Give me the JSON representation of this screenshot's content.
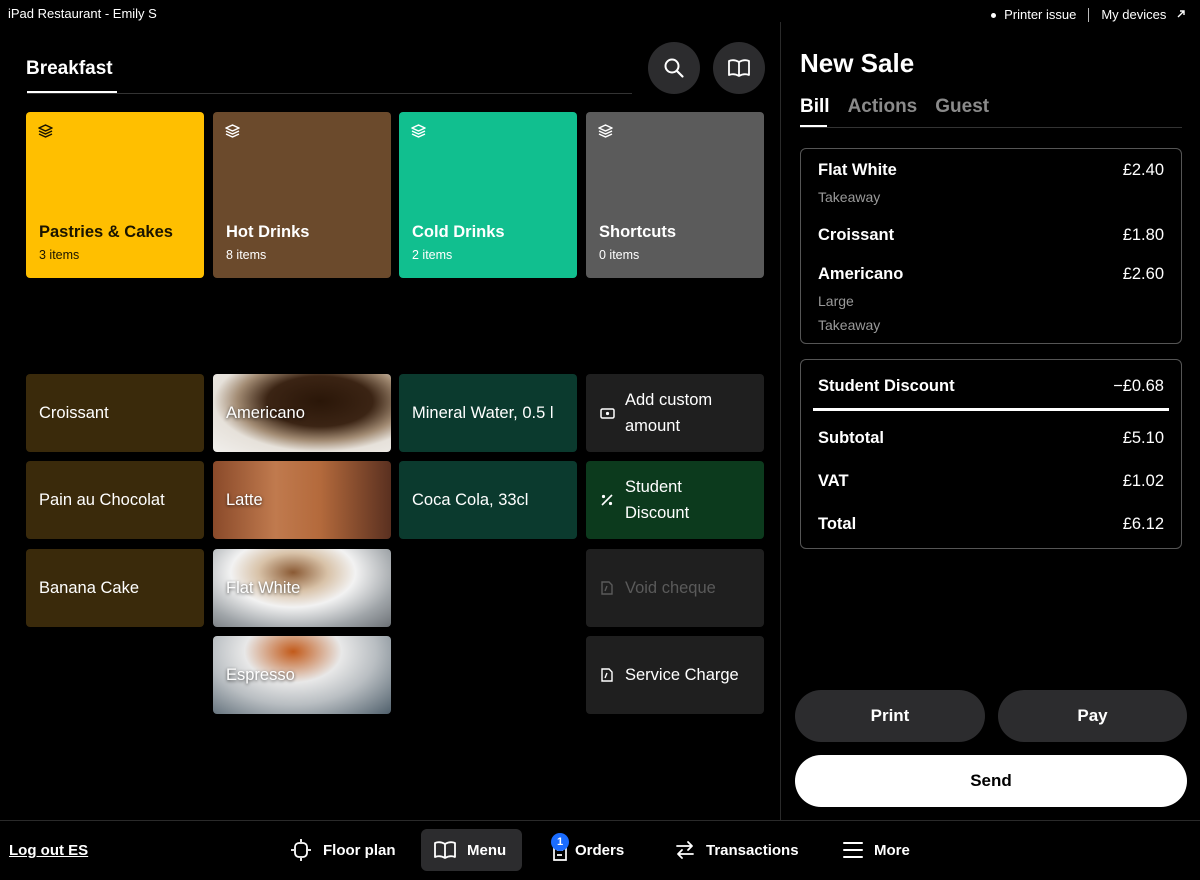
{
  "status_bar": {
    "left": "iPad Restaurant - Emily S",
    "printer_issue": "Printer issue",
    "my_devices": "My devices"
  },
  "menu": {
    "section_title": "Breakfast",
    "categories": [
      {
        "name": "Pastries & Cakes",
        "count": "3 items",
        "color": "#ffbf00",
        "text_color": "#1a1400"
      },
      {
        "name": "Hot Drinks",
        "count": "8 items",
        "color": "#6b4a2c",
        "text_color": "#ffffff"
      },
      {
        "name": "Cold Drinks",
        "count": "2 items",
        "color": "#11bf8f",
        "text_color": "#ffffff"
      },
      {
        "name": "Shortcuts",
        "count": "0 items",
        "color": "#5b5b5b",
        "text_color": "#ffffff"
      }
    ],
    "food_items": [
      "Croissant",
      "Pain au Chocolat",
      "Banana Cake"
    ],
    "photo_items": [
      "Americano",
      "Latte",
      "Flat White",
      "Espresso"
    ],
    "drink_items": [
      "Mineral Water, 0.5 l",
      "Coca Cola, 33cl"
    ],
    "actions": {
      "custom_amount": "Add custom amount",
      "student_discount": "Student Discount",
      "void_cheque": "Void cheque",
      "service_charge": "Service Charge"
    }
  },
  "sale": {
    "title": "New Sale",
    "tabs": [
      "Bill",
      "Actions",
      "Guest"
    ],
    "lines": [
      {
        "name": "Flat White",
        "price": "£2.40",
        "modifiers": [
          "Takeaway"
        ]
      },
      {
        "name": "Croissant",
        "price": "£1.80",
        "modifiers": []
      },
      {
        "name": "Americano",
        "price": "£2.60",
        "modifiers": [
          "Large",
          "Takeaway"
        ]
      }
    ],
    "discount": {
      "name": "Student Discount",
      "amount": "−£0.68"
    },
    "subtotal": {
      "label": "Subtotal",
      "value": "£5.10"
    },
    "vat": {
      "label": "VAT",
      "value": "£1.02"
    },
    "total": {
      "label": "Total",
      "value": "£6.12"
    },
    "buttons": {
      "print": "Print",
      "pay": "Pay",
      "send": "Send"
    }
  },
  "bottom_nav": {
    "logout": "Log out ES",
    "items": [
      {
        "label": "Floor plan",
        "icon": "floor-plan-icon"
      },
      {
        "label": "Menu",
        "icon": "book-icon"
      },
      {
        "label": "Orders",
        "icon": "orders-icon",
        "badge": "1"
      },
      {
        "label": "Transactions",
        "icon": "swap-arrows-icon"
      },
      {
        "label": "More",
        "icon": "hamburger-icon"
      }
    ]
  }
}
